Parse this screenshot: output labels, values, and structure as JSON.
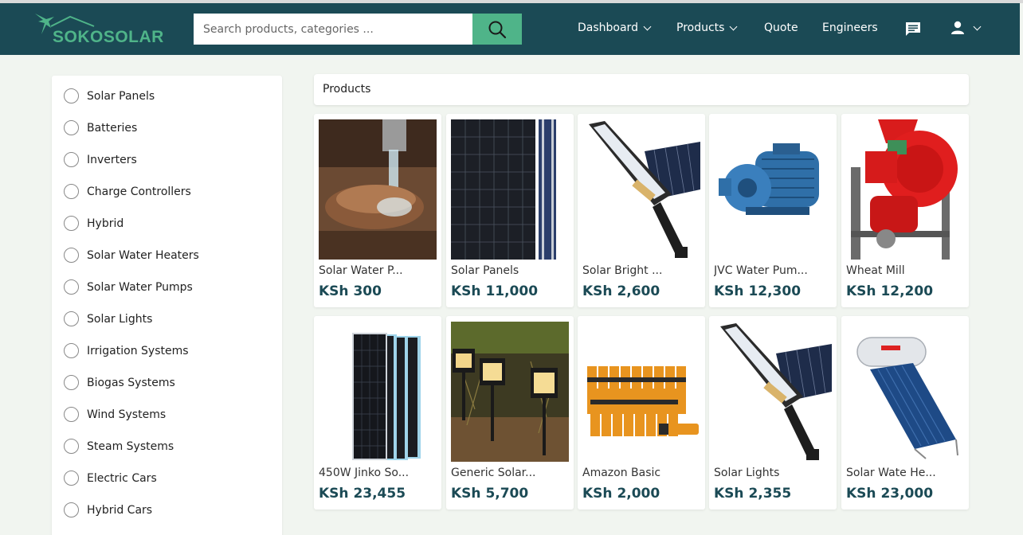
{
  "brand": {
    "name": "SOKOSOLAR"
  },
  "search": {
    "placeholder": "Search products, categories ...",
    "icon": "search-icon"
  },
  "nav": {
    "dashboard": "Dashboard",
    "products": "Products",
    "quote": "Quote",
    "engineers": "Engineers"
  },
  "colors": {
    "navbar": "#1b4a55",
    "accent": "#4fb489",
    "price": "#1b4a55",
    "page_bg": "#f1f5f0"
  },
  "categories": [
    "Solar Panels",
    "Batteries",
    "Inverters",
    "Charge Controllers",
    "Hybrid",
    "Solar Water Heaters",
    "Solar Water Pumps",
    "Solar Lights",
    "Irrigation Systems",
    "Biogas Systems",
    "Wind Systems",
    "Steam Systems",
    "Electric Cars",
    "Hybrid Cars"
  ],
  "products_header": "Products",
  "products": [
    {
      "name": "Solar Water P...",
      "price": "KSh 300",
      "image": "water-from-tap-image"
    },
    {
      "name": "Solar Panels",
      "price": "KSh 11,000",
      "image": "solar-panel-image"
    },
    {
      "name": "Solar Bright ...",
      "price": "KSh 2,600",
      "image": "street-light-image"
    },
    {
      "name": "JVC Water Pum...",
      "price": "KSh 12,300",
      "image": "water-pump-image"
    },
    {
      "name": "Wheat Mill",
      "price": "KSh 12,200",
      "image": "wheat-mill-image"
    },
    {
      "name": "450W Jinko So...",
      "price": "KSh 23,455",
      "image": "panel-stack-image"
    },
    {
      "name": "Generic Solar...",
      "price": "KSh 5,700",
      "image": "garden-lights-image"
    },
    {
      "name": "Amazon Basic",
      "price": "KSh 2,000",
      "image": "batteries-image"
    },
    {
      "name": "Solar Lights",
      "price": "KSh 2,355",
      "image": "street-light-image"
    },
    {
      "name": "Solar Wate He...",
      "price": "KSh 23,000",
      "image": "water-heater-image"
    }
  ]
}
